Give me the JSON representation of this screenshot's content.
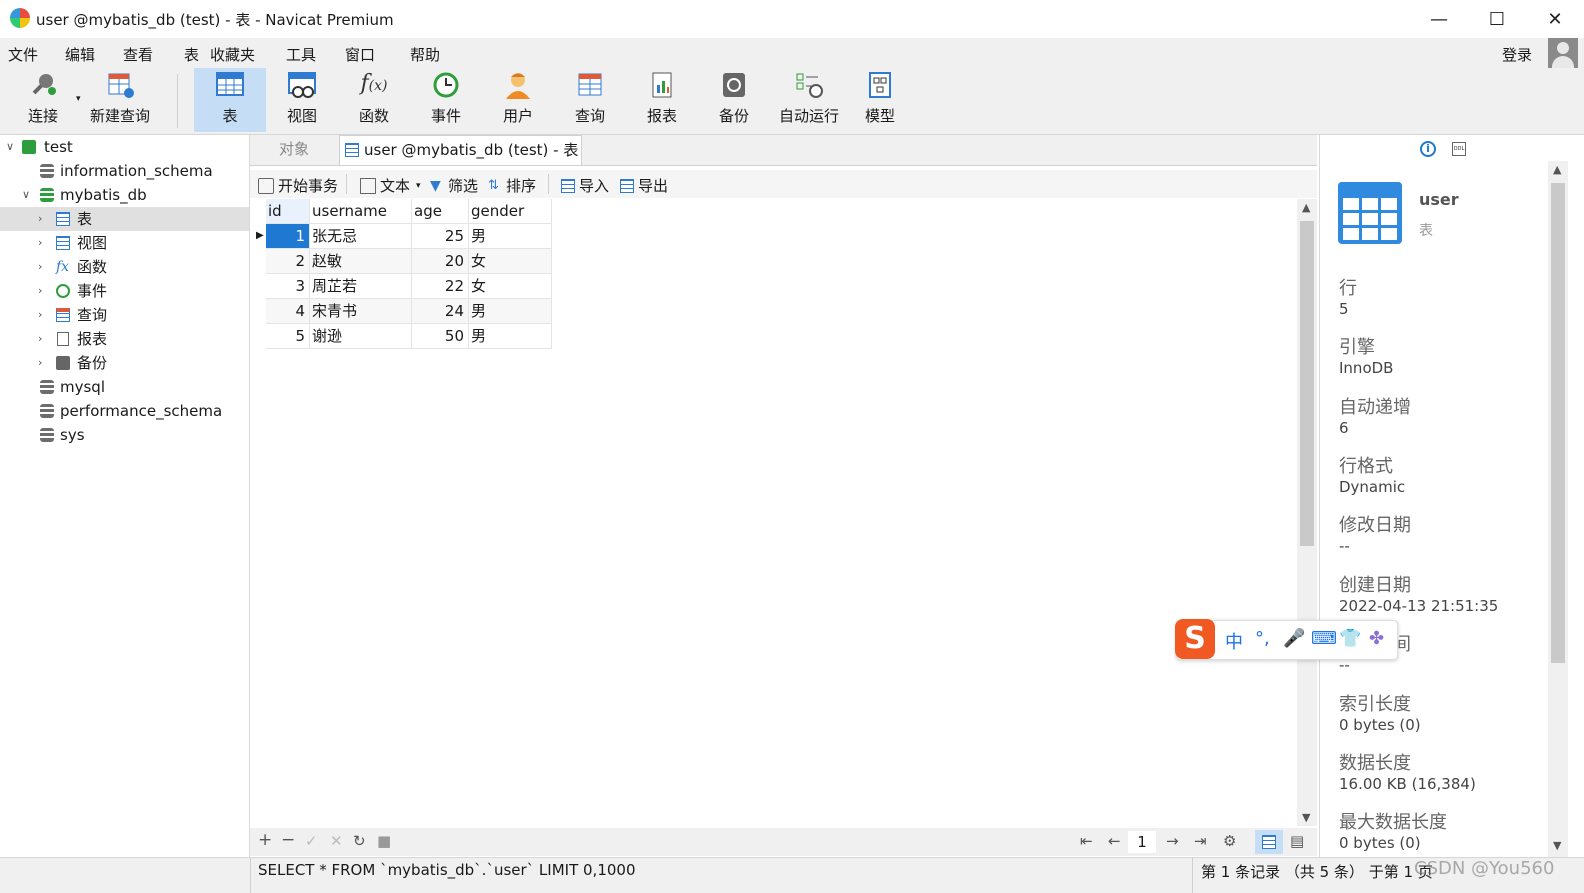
{
  "window": {
    "title": "user @mybatis_db (test) - 表 - Navicat Premium",
    "controls": {
      "minimize": "—",
      "maximize": "☐",
      "close": "✕"
    }
  },
  "menu": {
    "items": [
      "文件",
      "编辑",
      "查看",
      "表",
      "收藏夹",
      "工具",
      "窗口",
      "帮助"
    ],
    "login": "登录"
  },
  "toolbar": {
    "buttons": [
      {
        "label": "连接",
        "icon": "plug-icon"
      },
      {
        "label": "新建查询",
        "icon": "new-query-icon"
      },
      {
        "label": "表",
        "icon": "table-icon",
        "active": true
      },
      {
        "label": "视图",
        "icon": "view-icon"
      },
      {
        "label": "函数",
        "icon": "function-icon"
      },
      {
        "label": "事件",
        "icon": "clock-icon"
      },
      {
        "label": "用户",
        "icon": "user-icon"
      },
      {
        "label": "查询",
        "icon": "query-icon"
      },
      {
        "label": "报表",
        "icon": "report-icon"
      },
      {
        "label": "备份",
        "icon": "backup-icon"
      },
      {
        "label": "自动运行",
        "icon": "automation-icon"
      },
      {
        "label": "模型",
        "icon": "model-icon"
      }
    ]
  },
  "tree": {
    "connection": "test",
    "databases": [
      {
        "name": "information_schema"
      },
      {
        "name": "mybatis_db",
        "expanded": true,
        "children": [
          "表",
          "视图",
          "函数",
          "事件",
          "查询",
          "报表",
          "备份"
        ]
      },
      {
        "name": "mysql"
      },
      {
        "name": "performance_schema"
      },
      {
        "name": "sys"
      }
    ]
  },
  "tabs": {
    "objects": "对象",
    "active": "user @mybatis_db (test) - 表"
  },
  "grid_toolbar": {
    "begin_transaction": "开始事务",
    "text": "文本",
    "filter": "筛选",
    "sort": "排序",
    "import": "导入",
    "export": "导出"
  },
  "table": {
    "columns": [
      "id",
      "username",
      "age",
      "gender"
    ],
    "rows": [
      [
        "1",
        "张无忌",
        "25",
        "男"
      ],
      [
        "2",
        "赵敏",
        "20",
        "女"
      ],
      [
        "3",
        "周芷若",
        "22",
        "女"
      ],
      [
        "4",
        "宋青书",
        "24",
        "男"
      ],
      [
        "5",
        "谢逊",
        "50",
        "男"
      ]
    ]
  },
  "pager": {
    "page": "1"
  },
  "status": {
    "sql": "SELECT * FROM `mybatis_db`.`user` LIMIT 0,1000",
    "record_info": "第 1 条记录 （共 5 条） 于第 1 页",
    "watermark": "CSDN @You560"
  },
  "info_panel": {
    "name": "user",
    "type": "表",
    "fields": [
      {
        "label": "行",
        "value": "5"
      },
      {
        "label": "引擎",
        "value": "InnoDB"
      },
      {
        "label": "自动递增",
        "value": "6"
      },
      {
        "label": "行格式",
        "value": "Dynamic"
      },
      {
        "label": "修改日期",
        "value": "--"
      },
      {
        "label": "创建日期",
        "value": "2022-04-13 21:51:35"
      },
      {
        "label": "检查时间",
        "value": "--"
      },
      {
        "label": "索引长度",
        "value": "0 bytes (0)"
      },
      {
        "label": "数据长度",
        "value": "16.00 KB (16,384)"
      },
      {
        "label": "最大数据长度",
        "value": "0 bytes (0)"
      }
    ]
  },
  "ime": {
    "mode": "中",
    "punct": "°,"
  },
  "colors": {
    "accent": "#1f78d1",
    "active_toolbar": "#c5ddf5",
    "chrome": "#f0f0f0"
  }
}
